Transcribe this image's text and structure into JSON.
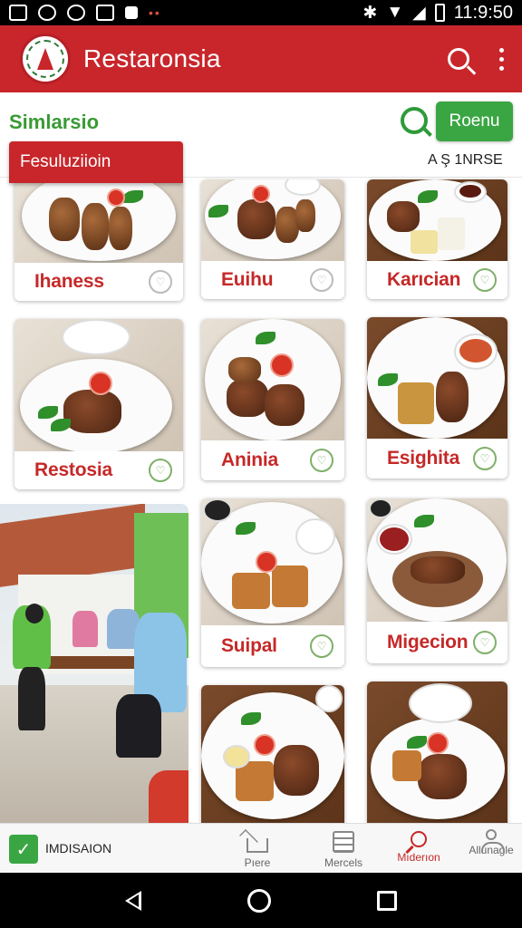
{
  "status_bar": {
    "time": "11:9:50"
  },
  "app_bar": {
    "title": "Restaronsia",
    "search_icon": "search-icon",
    "more_icon": "more-vert-icon"
  },
  "sub_header": {
    "title": "Simlarsio",
    "button_label": "Roenu",
    "tab_label": "Fesuluziioin",
    "sort_label": "A Ş 1NRSE"
  },
  "cards": [
    {
      "name": "Ihaness",
      "favorite_icon": "heart-icon"
    },
    {
      "name": "Euihu",
      "favorite_icon": "heart-icon"
    },
    {
      "name": "Karıcian",
      "favorite_icon": "heart-icon"
    },
    {
      "name": "Restosia",
      "favorite_icon": "heart-icon"
    },
    {
      "name": "Aninia",
      "favorite_icon": "heart-icon"
    },
    {
      "name": "Esighita",
      "favorite_icon": "heart-icon"
    },
    {
      "name": "Suipal",
      "favorite_icon": "heart-icon"
    },
    {
      "name": "Migecion",
      "favorite_icon": "heart-icon"
    }
  ],
  "bottom_bar": {
    "badge_label": "IMDISAION",
    "nav": [
      {
        "label": "Pıere",
        "icon": "home-icon"
      },
      {
        "label": "Mercels",
        "icon": "list-icon"
      },
      {
        "label": "Mıderıon",
        "icon": "search-icon"
      },
      {
        "label": "Allunagle",
        "icon": "user-icon"
      }
    ]
  },
  "colors": {
    "primary": "#c8262b",
    "accent": "#3aa643"
  }
}
